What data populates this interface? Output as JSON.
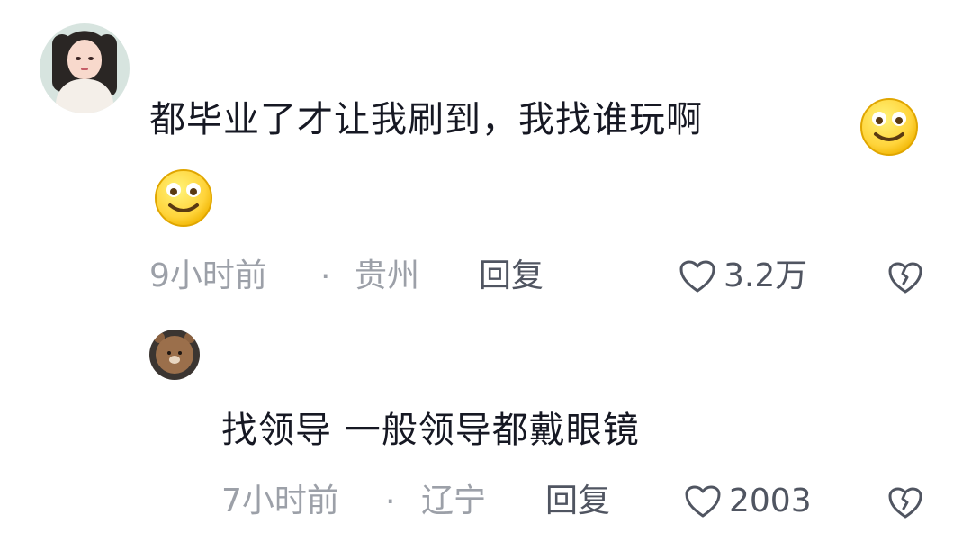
{
  "comment": {
    "text": "都毕业了才让我刷到，我找谁玩啊",
    "time": "9小时前",
    "separator": "·",
    "location": "贵州",
    "reply_label": "回复",
    "like_count": "3.2万"
  },
  "reply": {
    "text": "找领导 一般领导都戴眼镜",
    "time": "7小时前",
    "separator": "·",
    "location": "辽宁",
    "reply_label": "回复",
    "like_count": "2003"
  },
  "icons": {
    "like": "heart-outline-icon",
    "dislike": "broken-heart-outline-icon",
    "emoji": "smiling-face-emoji"
  },
  "colors": {
    "text_primary": "#161823",
    "text_meta": "#9ca0a8",
    "text_action": "#505561"
  }
}
